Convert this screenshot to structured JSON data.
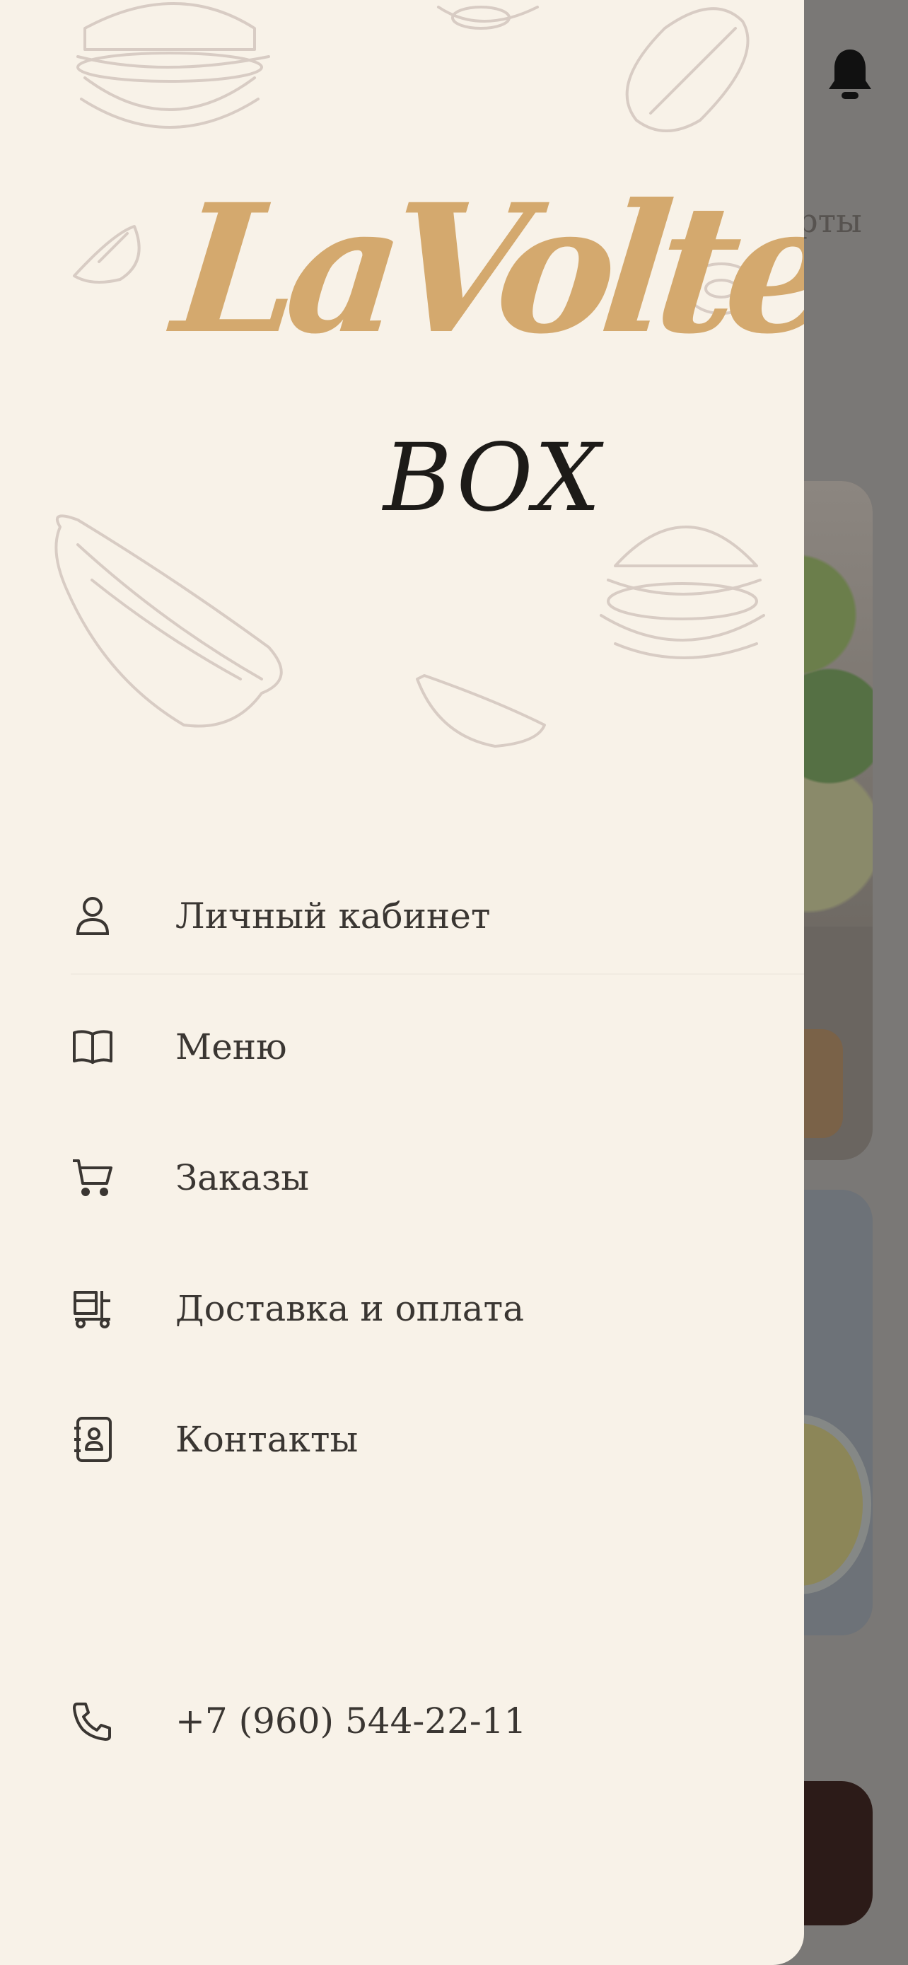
{
  "background": {
    "tab_partial": "ерты"
  },
  "drawer": {
    "logo": {
      "main": "LaVolte",
      "sub": "BOX"
    },
    "menu": [
      {
        "label": "Личный кабинет",
        "icon": "user-icon"
      },
      {
        "label": "Меню",
        "icon": "book-icon"
      },
      {
        "label": "Заказы",
        "icon": "cart-icon"
      },
      {
        "label": "Доставка и оплата",
        "icon": "delivery-icon"
      },
      {
        "label": "Контакты",
        "icon": "contacts-icon"
      }
    ],
    "phone": {
      "label": "+7 (960) 544-22-11",
      "icon": "phone-icon"
    }
  },
  "colors": {
    "drawer_bg": "#f8f2e8",
    "logo_gold": "#d4a96e",
    "text": "#3a3632",
    "overlay": "#7a7876"
  }
}
